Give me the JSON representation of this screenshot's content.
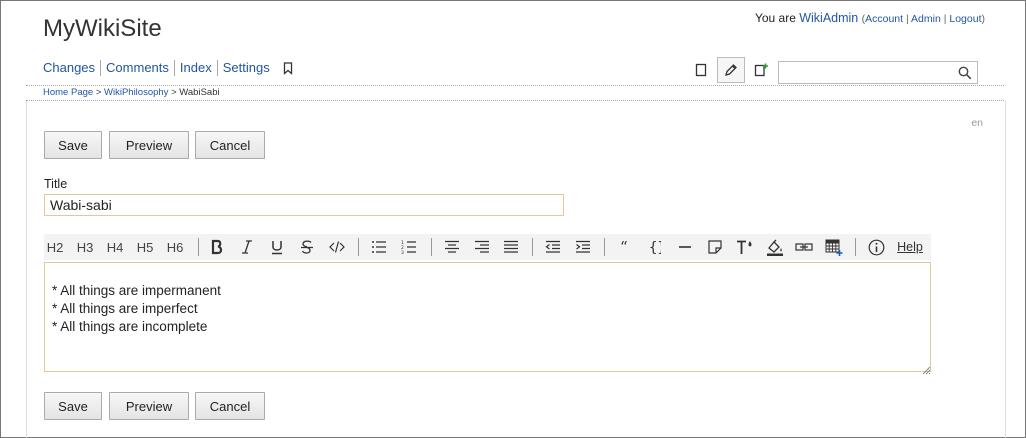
{
  "site": {
    "title": "MyWikiSite"
  },
  "user": {
    "prefix": "You are",
    "name": "WikiAdmin",
    "links": [
      "Account",
      "Admin",
      "Logout"
    ]
  },
  "nav": {
    "links": [
      "Changes",
      "Comments",
      "Index",
      "Settings"
    ],
    "bookmark_icon": "bookmark-icon"
  },
  "page_tools": [
    "view-page-icon",
    "edit-pencil-icon",
    "new-page-icon"
  ],
  "search": {
    "placeholder": "",
    "value": ""
  },
  "breadcrumb": {
    "items": [
      "Home Page",
      "WikiPhilosophy"
    ],
    "separator": ">",
    "current": "WabiSabi"
  },
  "language": "en",
  "buttons": {
    "save": "Save",
    "preview": "Preview",
    "cancel": "Cancel"
  },
  "form": {
    "title_label": "Title",
    "title_value": "Wabi-sabi",
    "content": "* All things are impermanent\n* All things are imperfect\n* All things are incomplete"
  },
  "toolbar": {
    "headings": [
      "H2",
      "H3",
      "H4",
      "H5",
      "H6"
    ],
    "help_label": "Help"
  },
  "colors": {
    "link": "#2255a4",
    "field_border": "#e6c79c"
  }
}
